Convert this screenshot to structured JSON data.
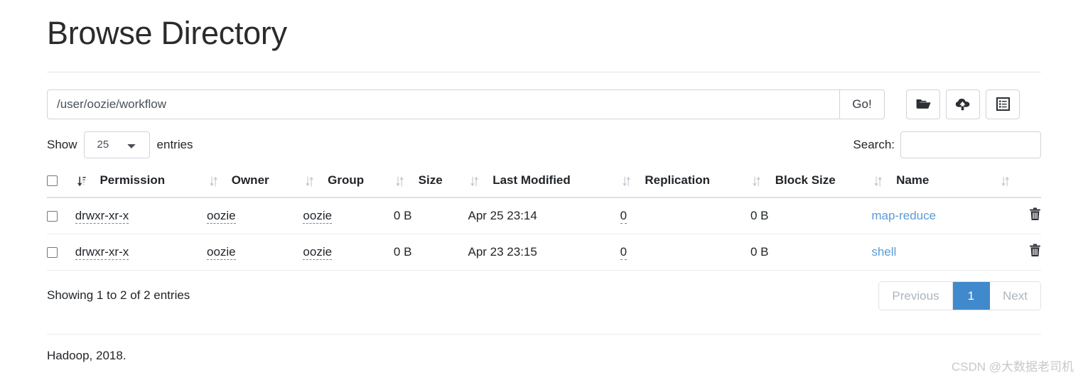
{
  "page": {
    "title": "Browse Directory"
  },
  "pathbar": {
    "path_value": "/user/oozie/workflow",
    "go_label": "Go!",
    "buttons": [
      {
        "name": "new-directory-button",
        "icon": "folder-open-icon"
      },
      {
        "name": "upload-button",
        "icon": "cloud-upload-icon"
      },
      {
        "name": "cut-paste-button",
        "icon": "list-clipboard-icon"
      }
    ]
  },
  "controls": {
    "show_label": "Show",
    "entries_label": "entries",
    "page_length": "25",
    "page_length_options": [
      "25"
    ],
    "search_label": "Search:",
    "search_value": "",
    "search_placeholder": ""
  },
  "table": {
    "columns": [
      {
        "label": "Permission"
      },
      {
        "label": "Owner"
      },
      {
        "label": "Group"
      },
      {
        "label": "Size"
      },
      {
        "label": "Last Modified"
      },
      {
        "label": "Replication"
      },
      {
        "label": "Block Size"
      },
      {
        "label": "Name"
      }
    ],
    "rows": [
      {
        "permission": "drwxr-xr-x",
        "owner": "oozie",
        "group": "oozie",
        "size": "0 B",
        "last_modified": "Apr 25 23:14",
        "replication": "0",
        "block_size": "0 B",
        "name": "map-reduce"
      },
      {
        "permission": "drwxr-xr-x",
        "owner": "oozie",
        "group": "oozie",
        "size": "0 B",
        "last_modified": "Apr 23 23:15",
        "replication": "0",
        "block_size": "0 B",
        "name": "shell"
      }
    ]
  },
  "footer_bar": {
    "info": "Showing 1 to 2 of 2 entries",
    "previous_label": "Previous",
    "page_1_label": "1",
    "next_label": "Next"
  },
  "footer": {
    "text": "Hadoop, 2018."
  },
  "watermark": {
    "text": "CSDN @大数据老司机"
  },
  "colors": {
    "accent": "#4189cd",
    "link": "#5b9bd5",
    "editable_underline": "#4a90d9",
    "border": "#ced4da"
  }
}
